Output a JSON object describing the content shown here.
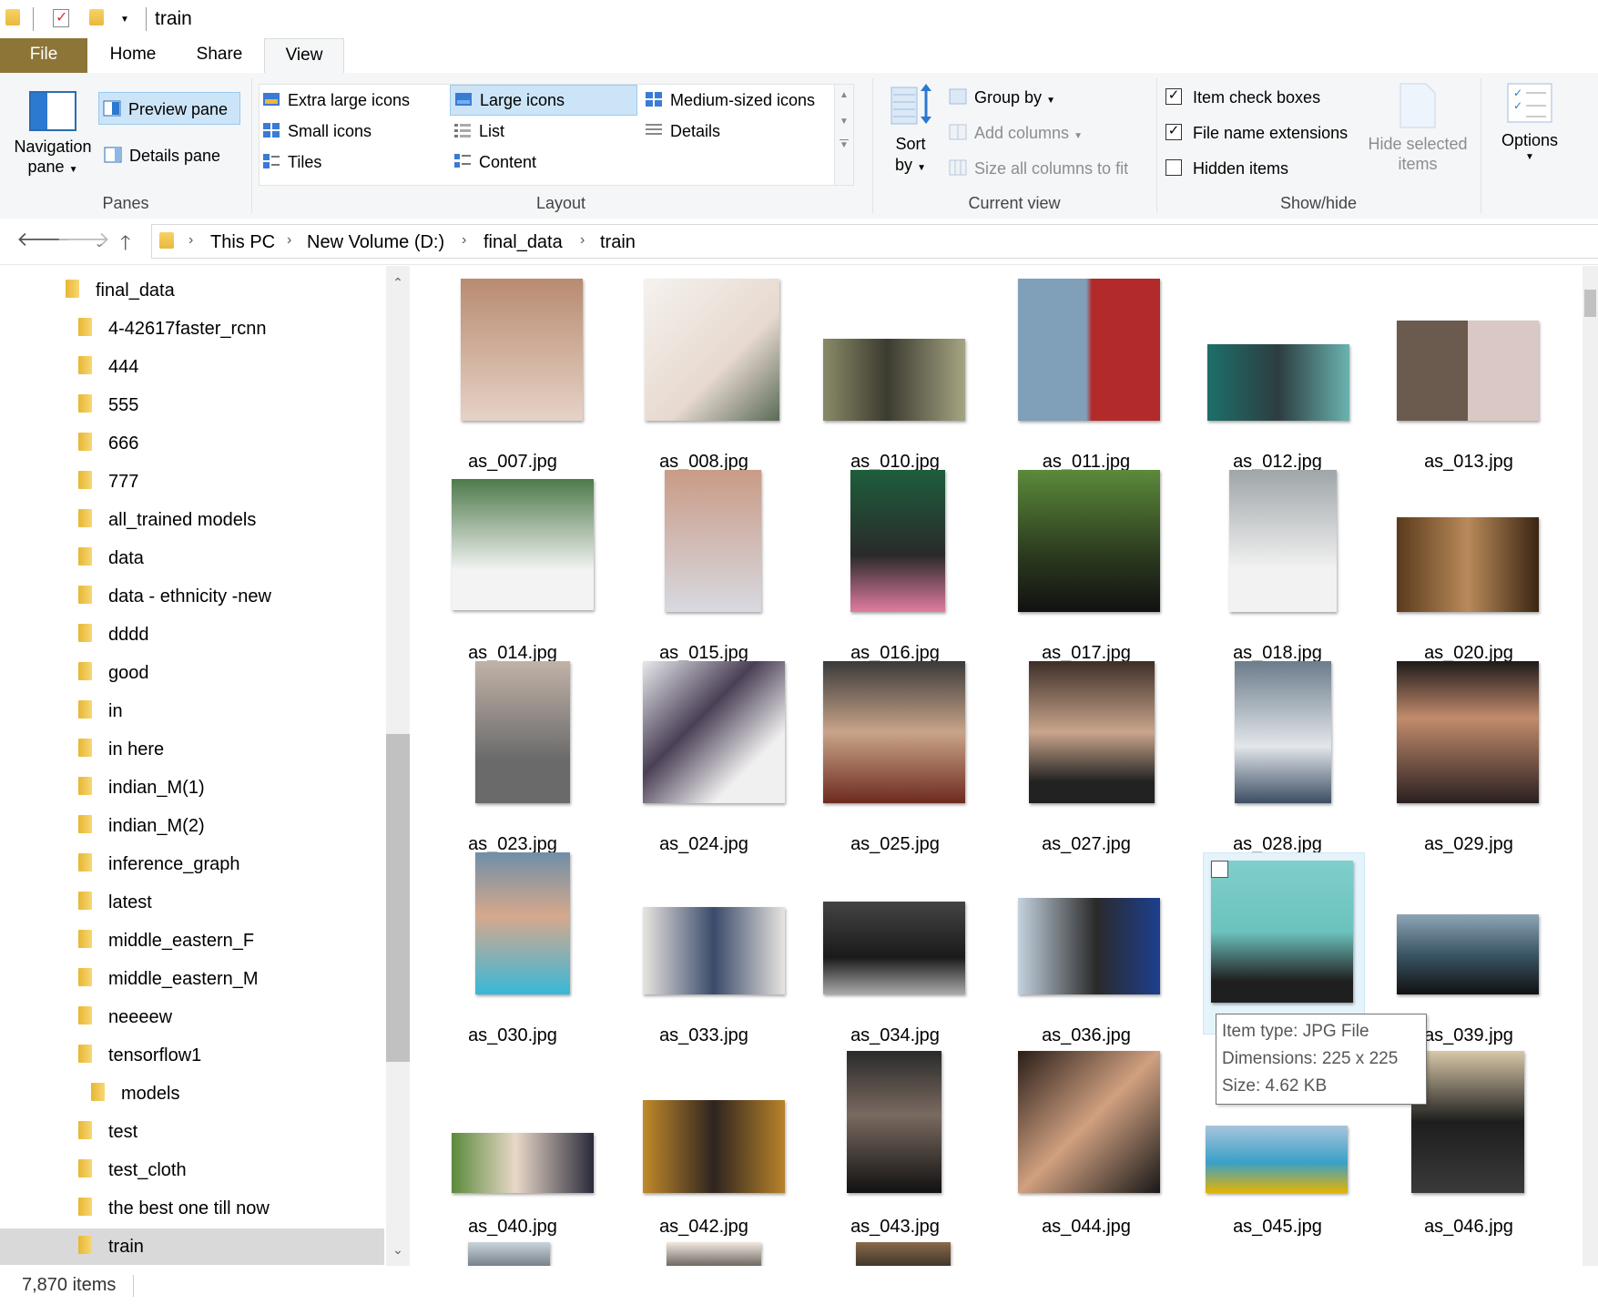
{
  "window": {
    "title": "train"
  },
  "tabs": {
    "file": "File",
    "home": "Home",
    "share": "Share",
    "view": "View"
  },
  "ribbon": {
    "panes": {
      "label": "Panes",
      "navigation_pane": "Navigation",
      "navigation_pane_2": "pane",
      "preview_pane": "Preview pane",
      "details_pane": "Details pane"
    },
    "layout": {
      "label": "Layout",
      "extra_large_icons": "Extra large icons",
      "large_icons": "Large icons",
      "medium_icons": "Medium-sized icons",
      "small_icons": "Small icons",
      "list": "List",
      "details": "Details",
      "tiles": "Tiles",
      "content": "Content"
    },
    "current_view": {
      "label": "Current view",
      "sort_by": "Sort",
      "sort_by_2": "by",
      "group_by": "Group by",
      "add_columns": "Add columns",
      "size_columns": "Size all columns to fit"
    },
    "show_hide": {
      "label": "Show/hide",
      "item_check_boxes": "Item check boxes",
      "file_name_extensions": "File name extensions",
      "hidden_items": "Hidden items",
      "hide_selected": "Hide selected",
      "hide_selected_2": "items",
      "item_check_boxes_checked": true,
      "file_name_extensions_checked": true,
      "hidden_items_checked": false
    },
    "options": {
      "label": "Options"
    }
  },
  "breadcrumb": [
    "This PC",
    "New Volume (D:)",
    "final_data",
    "train"
  ],
  "sidebar": {
    "items": [
      "final_data",
      "4-42617faster_rcnn",
      "444",
      "555",
      "666",
      "777",
      "all_trained models",
      "data",
      "data - ethnicity -new",
      "dddd",
      "good",
      "in",
      "in here",
      "indian_M(1)",
      "indian_M(2)",
      "inference_graph",
      "latest",
      "middle_eastern_F",
      "middle_eastern_M",
      "neeeew",
      "tensorflow1",
      "models",
      "test",
      "test_cloth",
      "the best one till now",
      "train"
    ]
  },
  "files": [
    "as_007.jpg",
    "as_008.jpg",
    "as_010.jpg",
    "as_011.jpg",
    "as_012.jpg",
    "as_013.jpg",
    "as_014.jpg",
    "as_015.jpg",
    "as_016.jpg",
    "as_017.jpg",
    "as_018.jpg",
    "as_020.jpg",
    "as_023.jpg",
    "as_024.jpg",
    "as_025.jpg",
    "as_027.jpg",
    "as_028.jpg",
    "as_029.jpg",
    "as_030.jpg",
    "as_033.jpg",
    "as_034.jpg",
    "as_036.jpg",
    "",
    "as_039.jpg",
    "as_040.jpg",
    "as_042.jpg",
    "as_043.jpg",
    "as_044.jpg",
    "as_045.jpg",
    "as_046.jpg"
  ],
  "tooltip": {
    "line1": "Item type: JPG File",
    "line2": "Dimensions: 225 x 225",
    "line3": "Size: 4.62 KB"
  },
  "status": {
    "item_count": "7,870 items"
  },
  "colors": {
    "file_tab": "#8d7437",
    "selection": "#cce4f7",
    "hover": "#e5f3fb",
    "folder": "#f2c94c"
  }
}
